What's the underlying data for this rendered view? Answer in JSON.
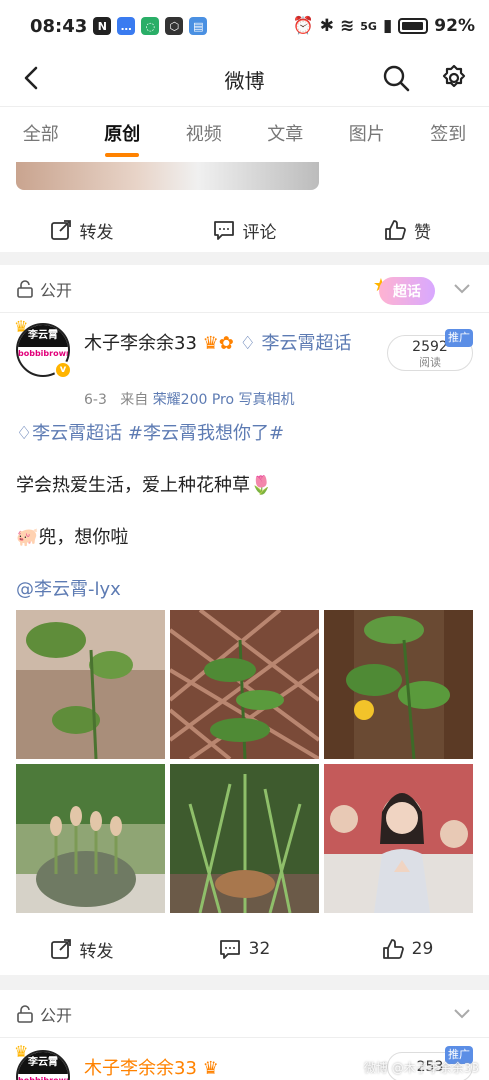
{
  "status_bar": {
    "time": "08:43",
    "battery": "92%",
    "network": "5G"
  },
  "header": {
    "title": "微博"
  },
  "tabs": [
    {
      "label": "全部",
      "active": false
    },
    {
      "label": "原创",
      "active": true
    },
    {
      "label": "视频",
      "active": false
    },
    {
      "label": "文章",
      "active": false
    },
    {
      "label": "图片",
      "active": false
    },
    {
      "label": "签到",
      "active": false
    }
  ],
  "prev_post": {
    "repost_label": "转发",
    "comment_label": "评论",
    "like_label": "赞"
  },
  "post": {
    "visibility": "公开",
    "chao_badge": "超话",
    "username": "木子李余余33",
    "chao_link": "李云霄超话",
    "date": "6-3",
    "source_prefix": "来自",
    "device": "荣耀200 Pro 写真相机",
    "read_count": "2592",
    "read_label": "阅读",
    "promo": "推广",
    "avatar_top": "李云霄",
    "avatar_mid": "bobbibrown",
    "hashtags": "李云霄超话  #李云霄我想你了#",
    "line1": "学会热爱生活，爱上种花种草🌷",
    "line2": "🐖兜，想你啦",
    "mention": "@李云霄-lyx",
    "repost_label": "转发",
    "comment_count": "32",
    "like_count": "29"
  },
  "next_post": {
    "visibility": "公开",
    "username": "木子李余余33",
    "read_count": "253",
    "promo": "推广",
    "watermark": "微博 @木子李余余33"
  },
  "colors": {
    "accent": "#ff8200",
    "link": "#5d7bb3",
    "promo": "#5b8ee6"
  }
}
